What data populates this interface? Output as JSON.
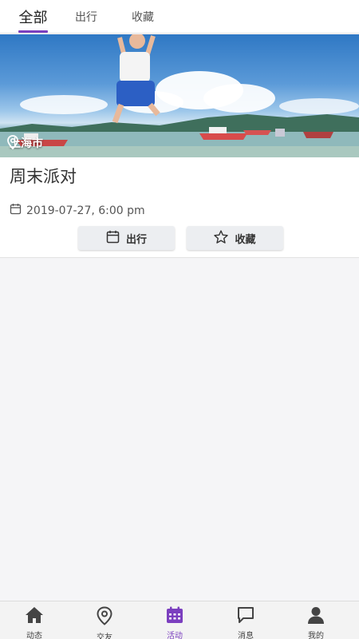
{
  "tabs": [
    {
      "label": "全部",
      "active": true
    },
    {
      "label": "出行",
      "active": false
    },
    {
      "label": "收藏",
      "active": false
    }
  ],
  "event": {
    "location": "上海市",
    "title": "周末派对",
    "datetime": "2019-07-27, 6:00 pm",
    "go_button": "出行",
    "favorite_button": "收藏"
  },
  "bottom_nav": [
    {
      "label": "动态",
      "icon": "home-icon",
      "active": false
    },
    {
      "label": "交友",
      "icon": "location-pin-icon",
      "active": false
    },
    {
      "label": "活动",
      "icon": "calendar-icon",
      "active": true
    },
    {
      "label": "消息",
      "icon": "chat-bubble-icon",
      "active": false
    },
    {
      "label": "我的",
      "icon": "person-icon",
      "active": false
    }
  ],
  "colors": {
    "accent": "#7b3fbf",
    "background": "#f5f5f7",
    "button_bg": "#eceef1"
  }
}
